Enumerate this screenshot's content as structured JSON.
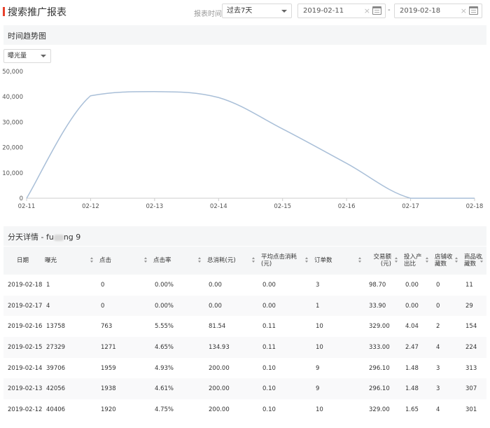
{
  "header": {
    "title": "搜索推广报表",
    "range_label": "报表时间",
    "range_value": "过去7天",
    "date_start": "2019-02-11",
    "date_end": "2019-02-18",
    "date_separator": "-",
    "clear_glyph": "×"
  },
  "trend": {
    "title": "时间趋势图",
    "metric": "曝光量"
  },
  "chart_data": {
    "type": "line",
    "categories": [
      "02-11",
      "02-12",
      "02-13",
      "02-14",
      "02-15",
      "02-16",
      "02-17",
      "02-18"
    ],
    "series": [
      {
        "values": [
          0,
          40406,
          42056,
          39706,
          27329,
          13758,
          4,
          1
        ],
        "color": "#a9bfd8"
      }
    ],
    "yticks": [
      "0",
      "10,000",
      "20,000",
      "30,000",
      "40,000",
      "50,000"
    ],
    "ylim": [
      0,
      50000
    ],
    "grid": false
  },
  "detail": {
    "title_prefix": "分天详情 - fu",
    "title_suffix": "ng 9"
  },
  "table": {
    "columns": [
      "日期",
      "曝光",
      "点击",
      "点击率",
      "总消耗(元)",
      "平均点击消耗(元)",
      "订单数",
      "交易额(元)",
      "投入产出比",
      "店铺收藏数",
      "商品收藏数"
    ],
    "rows": [
      [
        "2019-02-18",
        "1",
        "0",
        "0.00%",
        "0.00",
        "0.00",
        "3",
        "98.70",
        "0.00",
        "0",
        "11"
      ],
      [
        "2019-02-17",
        "4",
        "0",
        "0.00%",
        "0.00",
        "0.00",
        "1",
        "33.90",
        "0.00",
        "0",
        "29"
      ],
      [
        "2019-02-16",
        "13758",
        "763",
        "5.55%",
        "81.54",
        "0.11",
        "10",
        "329.00",
        "4.04",
        "2",
        "154"
      ],
      [
        "2019-02-15",
        "27329",
        "1271",
        "4.65%",
        "134.93",
        "0.11",
        "10",
        "333.00",
        "2.47",
        "4",
        "224"
      ],
      [
        "2019-02-14",
        "39706",
        "1959",
        "4.93%",
        "200.00",
        "0.10",
        "9",
        "296.10",
        "1.48",
        "3",
        "313"
      ],
      [
        "2019-02-13",
        "42056",
        "1938",
        "4.61%",
        "200.00",
        "0.10",
        "9",
        "296.10",
        "1.48",
        "3",
        "307"
      ],
      [
        "2019-02-12",
        "40406",
        "1920",
        "4.75%",
        "200.00",
        "0.10",
        "10",
        "329.00",
        "1.65",
        "4",
        "301"
      ]
    ]
  },
  "icons": {
    "calendar": "calendar-icon",
    "sort": "sort-icon",
    "dropdown": "chevron-down-icon"
  }
}
